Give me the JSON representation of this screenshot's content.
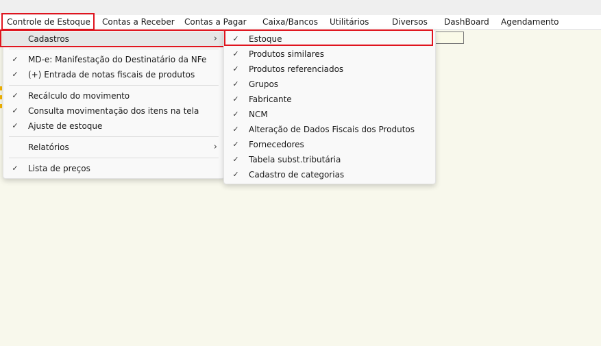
{
  "menubar": {
    "items": [
      {
        "label": "Controle de Estoque"
      },
      {
        "label": "Contas a Receber"
      },
      {
        "label": "Contas a Pagar"
      },
      {
        "label": "Caixa/Bancos"
      },
      {
        "label": "Utilitários"
      },
      {
        "label": "Diversos"
      },
      {
        "label": "DashBoard"
      },
      {
        "label": "Agendamento"
      }
    ]
  },
  "dropdown": {
    "items": [
      {
        "label": "Cadastros",
        "submenu_glyph": "›"
      },
      {
        "label": "MD-e: Manifestação do Destinatário da NFe",
        "check": "✓"
      },
      {
        "label": "(+) Entrada de notas fiscais de produtos",
        "check": "✓"
      },
      {
        "label": "Recálculo do movimento",
        "check": "✓"
      },
      {
        "label": "Consulta movimentação dos itens na tela",
        "check": "✓"
      },
      {
        "label": "Ajuste de estoque",
        "check": "✓"
      },
      {
        "label": "Relatórios",
        "submenu_glyph": "›"
      },
      {
        "label": "Lista de preços",
        "check": "✓"
      }
    ]
  },
  "submenu": {
    "items": [
      {
        "label": "Estoque",
        "check": "✓"
      },
      {
        "label": "Produtos similares",
        "check": "✓"
      },
      {
        "label": "Produtos referenciados",
        "check": "✓"
      },
      {
        "label": "Grupos",
        "check": "✓"
      },
      {
        "label": "Fabricante",
        "check": "✓"
      },
      {
        "label": "NCM",
        "check": "✓"
      },
      {
        "label": "Alteração de Dados Fiscais dos Produtos",
        "check": "✓"
      },
      {
        "label": "Fornecedores",
        "check": "✓"
      },
      {
        "label": "Tabela subst.tributária",
        "check": "✓"
      },
      {
        "label": "Cadastro de categorias",
        "check": "✓"
      }
    ]
  },
  "colors": {
    "highlight_border": "#e0141e",
    "background": "#f8f8ec",
    "menu_background": "#f9f9f9"
  }
}
